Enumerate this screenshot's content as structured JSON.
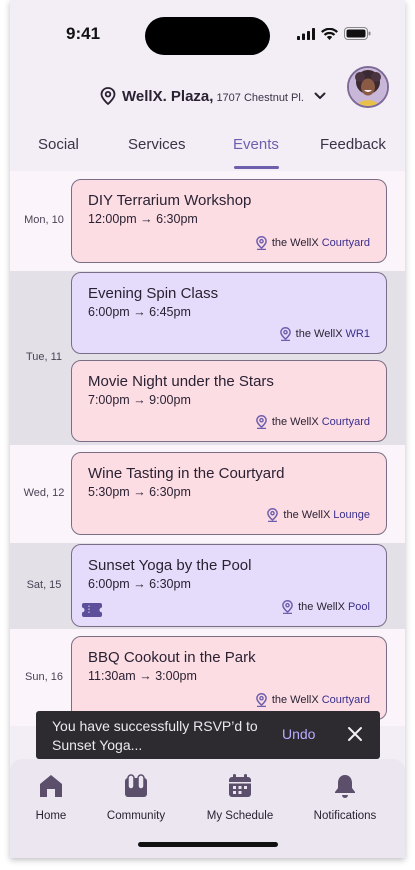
{
  "status_bar": {
    "time": "9:41"
  },
  "header": {
    "location_name": "WellX. Plaza,",
    "location_address": "1707 Chestnut Pl.",
    "location_icon": "location-pin-icon",
    "dropdown_icon": "chevron-down-icon"
  },
  "tabs": [
    {
      "label": "Social"
    },
    {
      "label": "Services"
    },
    {
      "label": "Events",
      "active": true
    },
    {
      "label": "Feedback"
    }
  ],
  "days": [
    {
      "label": "Mon, 10",
      "events": [
        {
          "title": "DIY Terrarium Workshop",
          "start": "12:00pm",
          "end": "6:30pm",
          "loc_prefix": "the WellX",
          "loc_place": "Courtyard",
          "color": "pink"
        }
      ]
    },
    {
      "label": "Tue, 11",
      "events": [
        {
          "title": "Evening Spin Class",
          "start": "6:00pm",
          "end": "6:45pm",
          "loc_prefix": "the WellX",
          "loc_place": "WR1",
          "color": "purple"
        },
        {
          "title": "Movie Night under the Stars",
          "start": "7:00pm",
          "end": "9:00pm",
          "loc_prefix": "the WellX",
          "loc_place": "Courtyard",
          "color": "pink"
        }
      ]
    },
    {
      "label": "Wed, 12",
      "events": [
        {
          "title": "Wine Tasting in the Courtyard",
          "start": "5:30pm",
          "end": "6:30pm",
          "loc_prefix": "the WellX",
          "loc_place": "Lounge",
          "color": "pink"
        }
      ]
    },
    {
      "label": "Sat, 15",
      "events": [
        {
          "title": "Sunset Yoga by the Pool",
          "start": "6:00pm",
          "end": "6:30pm",
          "loc_prefix": "the WellX",
          "loc_place": "Pool",
          "color": "purple",
          "ticket": true
        }
      ]
    },
    {
      "label": "Sun, 16",
      "events": [
        {
          "title": "BBQ Cookout in the Park",
          "start": "11:30am",
          "end": "3:00pm",
          "loc_prefix": "the WellX",
          "loc_place": "Courtyard",
          "color": "pink"
        }
      ]
    }
  ],
  "arrow": "→",
  "toast": {
    "message": "You have successfully RSVP’d to Sunset Yoga...",
    "undo_label": "Undo"
  },
  "bottom_nav": [
    {
      "label": "Home",
      "icon": "home-icon"
    },
    {
      "label": "Community",
      "icon": "community-icon"
    },
    {
      "label": "My Schedule",
      "icon": "calendar-icon"
    },
    {
      "label": "Notifications",
      "icon": "bell-icon"
    }
  ],
  "colors": {
    "accent": "#6e5fae",
    "card_pink": "#fddde4",
    "card_purple": "#e5dcfb",
    "location_text": "#3a2f8c",
    "toast_bg": "#2d2b30",
    "undo": "#b9acff"
  }
}
